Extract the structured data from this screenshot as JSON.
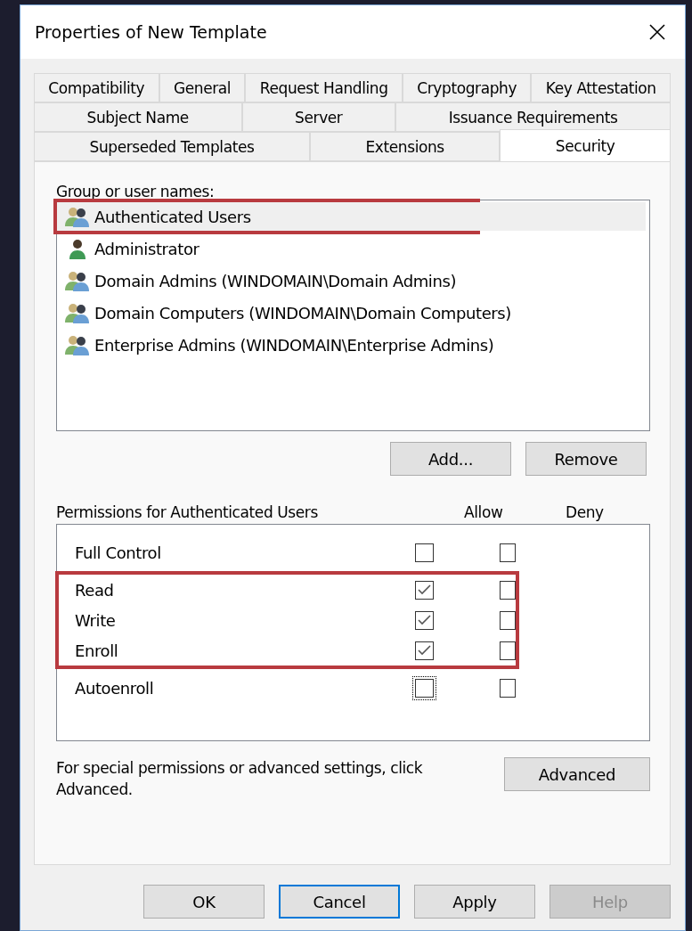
{
  "window": {
    "title": "Properties of New Template"
  },
  "tab_rows": [
    [
      {
        "label": "Compatibility",
        "selected": false
      },
      {
        "label": "General",
        "selected": false
      },
      {
        "label": "Request Handling",
        "selected": false
      },
      {
        "label": "Cryptography",
        "selected": false
      },
      {
        "label": "Key Attestation",
        "selected": false
      }
    ],
    [
      {
        "label": "Subject Name",
        "selected": false
      },
      {
        "label": "Server",
        "selected": false
      },
      {
        "label": "Issuance Requirements",
        "selected": false
      }
    ],
    [
      {
        "label": "Superseded Templates",
        "selected": false
      },
      {
        "label": "Extensions",
        "selected": false
      },
      {
        "label": "Security",
        "selected": true
      }
    ]
  ],
  "group_label": "Group or user names:",
  "users": [
    {
      "name": "Authenticated Users",
      "kind": "group",
      "selected": true,
      "highlighted": true
    },
    {
      "name": "Administrator",
      "kind": "user",
      "selected": false,
      "highlighted": false
    },
    {
      "name": "Domain Admins (WINDOMAIN\\Domain Admins)",
      "kind": "group",
      "selected": false,
      "highlighted": false
    },
    {
      "name": "Domain Computers (WINDOMAIN\\Domain Computers)",
      "kind": "group",
      "selected": false,
      "highlighted": false
    },
    {
      "name": "Enterprise Admins (WINDOMAIN\\Enterprise Admins)",
      "kind": "group",
      "selected": false,
      "highlighted": false
    }
  ],
  "user_buttons": [
    "Add...",
    "Remove"
  ],
  "permissions": {
    "label": "Permissions for Authenticated Users",
    "allow_heading": "Allow",
    "deny_heading": "Deny",
    "rows": [
      {
        "name": "Full Control",
        "allow": false,
        "deny": false,
        "highlighted": false,
        "focused": false
      },
      {
        "name": "Read",
        "allow": true,
        "deny": false,
        "highlighted": true,
        "focused": false
      },
      {
        "name": "Write",
        "allow": true,
        "deny": false,
        "highlighted": true,
        "focused": false
      },
      {
        "name": "Enroll",
        "allow": true,
        "deny": false,
        "highlighted": true,
        "focused": false
      },
      {
        "name": "Autoenroll",
        "allow": false,
        "deny": false,
        "highlighted": false,
        "focused": true
      }
    ]
  },
  "advanced": {
    "text": "For special permissions or advanced settings, click Advanced.",
    "button": "Advanced"
  },
  "buttons": [
    {
      "label": "OK",
      "default": false,
      "disabled": false
    },
    {
      "label": "Cancel",
      "default": true,
      "disabled": false
    },
    {
      "label": "Apply",
      "default": false,
      "disabled": false
    },
    {
      "label": "Help",
      "default": false,
      "disabled": true
    }
  ]
}
